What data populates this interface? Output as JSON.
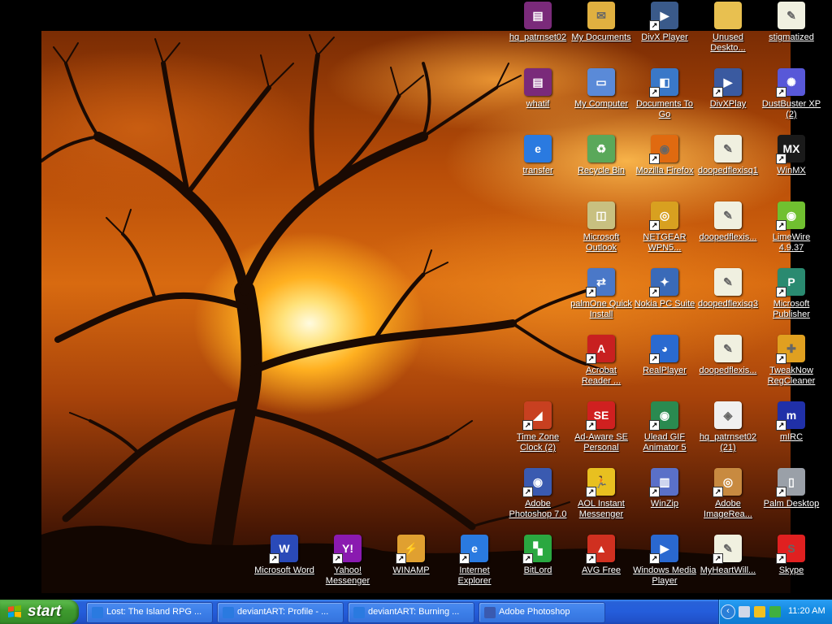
{
  "desktop": {
    "icons": [
      {
        "label": "hq_patrnset02",
        "icon": "winrar-archive-icon",
        "color": "#7a2a7a",
        "glyph": "▤",
        "shortcut": false
      },
      {
        "label": "My Documents",
        "icon": "my-documents-icon",
        "color": "#e0b040",
        "glyph": "✉",
        "shortcut": false
      },
      {
        "label": "DivX Player",
        "icon": "divx-player-icon",
        "color": "#3a5a8a",
        "glyph": "▶",
        "shortcut": true
      },
      {
        "label": "Unused\nDeskto...",
        "icon": "folder-icon",
        "color": "#e8c050",
        "glyph": "",
        "shortcut": false
      },
      {
        "label": "stigmatized",
        "icon": "text-document-icon",
        "color": "#f0f0e0",
        "glyph": "✎",
        "shortcut": false
      },
      {
        "label": "whatif",
        "icon": "winrar-archive-icon",
        "color": "#7a2a7a",
        "glyph": "▤",
        "shortcut": false
      },
      {
        "label": "My Computer",
        "icon": "my-computer-icon",
        "color": "#5a8ad8",
        "glyph": "▭",
        "shortcut": false
      },
      {
        "label": "Documents To\nGo",
        "icon": "documents-to-go-icon",
        "color": "#3a78c8",
        "glyph": "◧",
        "shortcut": true
      },
      {
        "label": "DivXPlay",
        "icon": "divxplay-icon",
        "color": "#3a5aa0",
        "glyph": "▶",
        "shortcut": true
      },
      {
        "label": "DustBuster XP\n(2)",
        "icon": "gear-icon",
        "color": "#5858d8",
        "glyph": "✺",
        "shortcut": true
      },
      {
        "label": "transfer",
        "icon": "internet-explorer-icon",
        "color": "#2a7ae0",
        "glyph": "e",
        "shortcut": false
      },
      {
        "label": "Recycle Bin",
        "icon": "recycle-bin-icon",
        "color": "#5aa85a",
        "glyph": "♻",
        "shortcut": false
      },
      {
        "label": "Mozilla Firefox",
        "icon": "firefox-icon",
        "color": "#e06a10",
        "glyph": "◉",
        "shortcut": true
      },
      {
        "label": "doopedflexisq1",
        "icon": "document-icon",
        "color": "#f0f0e0",
        "glyph": "✎",
        "shortcut": false
      },
      {
        "label": "WinMX",
        "icon": "winmx-icon",
        "color": "#1a1a1a",
        "glyph": "MX",
        "shortcut": true
      },
      {
        "label": "Microsoft\nOutlook",
        "icon": "outlook-icon",
        "color": "#c8c080",
        "glyph": "◫",
        "shortcut": false
      },
      {
        "label": "NETGEAR\nWPN5...",
        "icon": "netgear-icon",
        "color": "#d8a020",
        "glyph": "◎",
        "shortcut": true
      },
      {
        "label": "doopedflexis...",
        "icon": "document-icon",
        "color": "#f0f0e0",
        "glyph": "✎",
        "shortcut": false
      },
      {
        "label": "LimeWire\n4.9.37",
        "icon": "limewire-icon",
        "color": "#70c030",
        "glyph": "◉",
        "shortcut": true
      },
      {
        "label": "palmOne Quick\nInstall",
        "icon": "palm-install-icon",
        "color": "#4a78c8",
        "glyph": "⇄",
        "shortcut": true
      },
      {
        "label": "Nokia PC Suite",
        "icon": "nokia-pc-suite-icon",
        "color": "#3a6ab8",
        "glyph": "✦",
        "shortcut": true
      },
      {
        "label": "doopedflexisq3",
        "icon": "document-icon",
        "color": "#f0f0e0",
        "glyph": "✎",
        "shortcut": false
      },
      {
        "label": "Microsoft\nPublisher",
        "icon": "publisher-icon",
        "color": "#2a8a70",
        "glyph": "P",
        "shortcut": true
      },
      {
        "label": "Acrobat\nReader ...",
        "icon": "acrobat-reader-icon",
        "color": "#c82020",
        "glyph": "A",
        "shortcut": true
      },
      {
        "label": "RealPlayer",
        "icon": "realplayer-icon",
        "color": "#2a6ad0",
        "glyph": "◕",
        "shortcut": true
      },
      {
        "label": "doopedflexis...",
        "icon": "document-icon",
        "color": "#f0f0e0",
        "glyph": "✎",
        "shortcut": false
      },
      {
        "label": "TweakNow\nRegCleaner",
        "icon": "tweaknow-icon",
        "color": "#e0a020",
        "glyph": "✚",
        "shortcut": true
      },
      {
        "label": "Time Zone\nClock (2)",
        "icon": "time-zone-clock-icon",
        "color": "#c84020",
        "glyph": "◢",
        "shortcut": true
      },
      {
        "label": "Ad-Aware SE\nPersonal",
        "icon": "ad-aware-icon",
        "color": "#d02020",
        "glyph": "SE",
        "shortcut": true
      },
      {
        "label": "Ulead GIF\nAnimator 5",
        "icon": "ulead-gif-icon",
        "color": "#2a8a50",
        "glyph": "◉",
        "shortcut": true
      },
      {
        "label": "hq_patrnset02\n(21)",
        "icon": "image-file-icon",
        "color": "#f0f0f0",
        "glyph": "◈",
        "shortcut": false
      },
      {
        "label": "mIRC",
        "icon": "mirc-icon",
        "color": "#2030a8",
        "glyph": "m",
        "shortcut": true
      },
      {
        "label": "Adobe\nPhotoshop 7.0",
        "icon": "photoshop-icon",
        "color": "#3a5ab0",
        "glyph": "◉",
        "shortcut": true
      },
      {
        "label": "AOL Instant\nMessenger",
        "icon": "aim-icon",
        "color": "#e8c020",
        "glyph": "🏃",
        "shortcut": true
      },
      {
        "label": "WinZip",
        "icon": "winzip-icon",
        "color": "#5a70c8",
        "glyph": "▥",
        "shortcut": true
      },
      {
        "label": "Adobe\nImageRea...",
        "icon": "imageready-icon",
        "color": "#c88a40",
        "glyph": "◎",
        "shortcut": true
      },
      {
        "label": "Palm Desktop",
        "icon": "palm-desktop-icon",
        "color": "#9aa0a8",
        "glyph": "▯",
        "shortcut": true
      },
      {
        "label": "Microsoft Word",
        "icon": "word-icon",
        "color": "#2a4ab8",
        "glyph": "W",
        "shortcut": true
      },
      {
        "label": "Yahoo!\nMessenger",
        "icon": "yahoo-messenger-icon",
        "color": "#8a1ab0",
        "glyph": "Y!",
        "shortcut": true
      },
      {
        "label": "WINAMP",
        "icon": "winamp-icon",
        "color": "#e0a030",
        "glyph": "⚡",
        "shortcut": true
      },
      {
        "label": "Internet\nExplorer",
        "icon": "internet-explorer-icon",
        "color": "#2a7ae0",
        "glyph": "e",
        "shortcut": true
      },
      {
        "label": "BitLord",
        "icon": "bitlord-icon",
        "color": "#2aa840",
        "glyph": "▚",
        "shortcut": true
      },
      {
        "label": "AVG Free",
        "icon": "avg-free-icon",
        "color": "#d03020",
        "glyph": "▲",
        "shortcut": true
      },
      {
        "label": "Windows Media\nPlayer",
        "icon": "windows-media-player-icon",
        "color": "#2a68d0",
        "glyph": "▶",
        "shortcut": true
      },
      {
        "label": "MyHeartWill...",
        "icon": "document-icon",
        "color": "#f0f0e0",
        "glyph": "✎",
        "shortcut": true
      },
      {
        "label": "Skype",
        "icon": "skype-icon",
        "color": "#e02020",
        "glyph": "S",
        "shortcut": true
      }
    ]
  },
  "taskbar": {
    "start_label": "start",
    "tasks": [
      {
        "label": "Lost: The Island RPG ...",
        "icon": "internet-explorer-icon",
        "color": "#2a7ae0"
      },
      {
        "label": "deviantART: Profile - ...",
        "icon": "internet-explorer-icon",
        "color": "#2a7ae0"
      },
      {
        "label": "deviantART: Burning ...",
        "icon": "internet-explorer-icon",
        "color": "#2a7ae0"
      },
      {
        "label": "Adobe Photoshop",
        "icon": "photoshop-icon",
        "color": "#3a5ab0"
      }
    ],
    "tray": {
      "chevron": "‹",
      "icons": [
        {
          "icon": "volume-icon",
          "color": "#d0d8e8"
        },
        {
          "icon": "messenger-smiley-icon",
          "color": "#f0c020"
        },
        {
          "icon": "network-icon",
          "color": "#40b040"
        }
      ],
      "clock": "11:20 AM"
    }
  }
}
